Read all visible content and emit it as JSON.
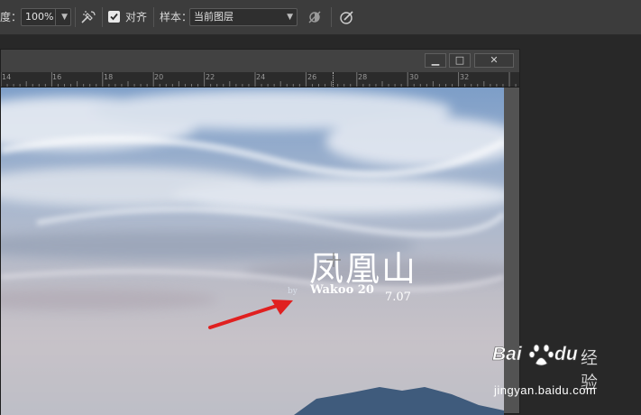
{
  "options_bar": {
    "opacity_label": "度：",
    "opacity_value": "100%",
    "align_label": "对齐",
    "align_checked": true,
    "sample_label": "样本：",
    "sample_value": "当前图层"
  },
  "document": {
    "window_buttons": {
      "minimize": "▁",
      "restore": "□",
      "close": "✕"
    },
    "ruler_numbers": [
      "14",
      "16",
      "18",
      "20",
      "22",
      "24",
      "26",
      "28",
      "30",
      "32"
    ]
  },
  "canvas": {
    "title_text": "凤凰山",
    "byline_left": "Wakoo  20",
    "byline_right": "7.07",
    "byline_prefix": "by"
  },
  "watermark": {
    "brand_bai": "Bai",
    "brand_du": "du",
    "brand_suffix": "经验",
    "url": "jingyan.baidu.com"
  },
  "colors": {
    "arrow": "#e02020",
    "sky_top": "#7a9cc6",
    "mountain": "#3f5b7c"
  }
}
